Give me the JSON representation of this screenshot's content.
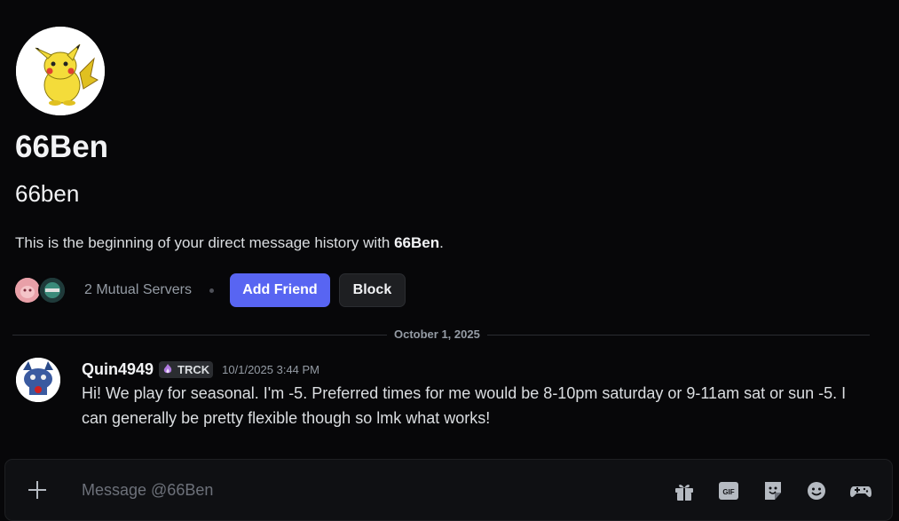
{
  "profile": {
    "display_name": "66Ben",
    "username": "66ben",
    "avatar_icon": "pikachu-avatar"
  },
  "intro": {
    "prefix": "This is the beginning of your direct message history with ",
    "name": "66Ben",
    "suffix": "."
  },
  "mutual": {
    "servers_label": "2 Mutual Servers",
    "add_friend_label": "Add Friend",
    "block_label": "Block"
  },
  "divider": {
    "date": "October 1, 2025"
  },
  "message": {
    "author": "Quin4949",
    "tag": "TRCK",
    "timestamp": "10/1/2025 3:44 PM",
    "text": "Hi! We play for seasonal. I'm -5. Preferred times for me would be 8-10pm saturday or 9-11am sat or sun -5. I can generally be pretty flexible though so lmk what works!"
  },
  "composer": {
    "placeholder": "Message @66Ben",
    "icons": [
      "plus-icon",
      "gift-icon",
      "gif-icon",
      "sticker-icon",
      "emoji-icon",
      "activity-icon"
    ]
  },
  "colors": {
    "background": "#070709",
    "accent": "#5865f2",
    "text_primary": "#f2f3f5",
    "text_muted": "#949ba4"
  }
}
